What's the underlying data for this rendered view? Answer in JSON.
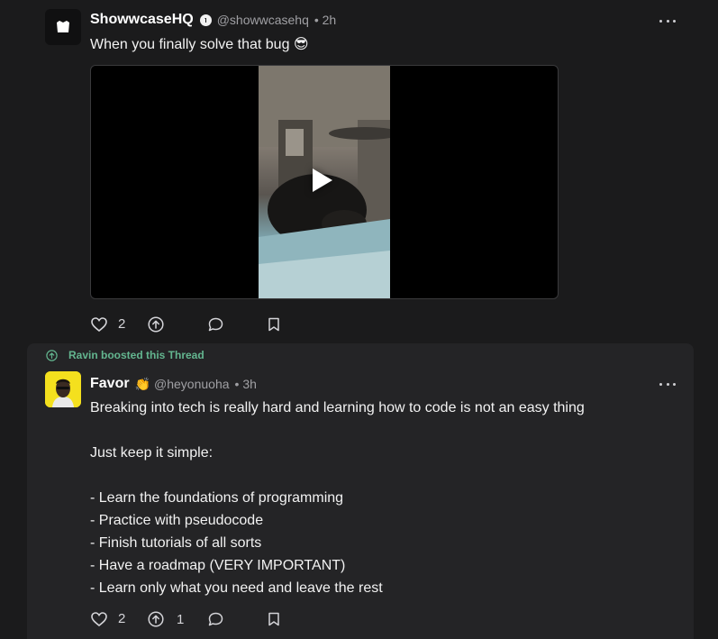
{
  "posts": [
    {
      "display_name": "ShowwcaseHQ",
      "handle": "@showwcasehq",
      "time": "• 2h",
      "text": "When you finally solve that bug 😎",
      "media": {
        "type": "video",
        "play_icon": "play-icon"
      },
      "likes": "2",
      "boosts": "",
      "icons": [
        "heart-icon",
        "boost-icon",
        "comment-icon",
        "bookmark-icon",
        "more-icon",
        "verified-icon"
      ]
    },
    {
      "boost_label": "Ravin boosted this Thread",
      "display_name": "Favor",
      "emoji": "👏",
      "handle": "@heyonuoha",
      "time": "• 3h",
      "text": "Breaking into tech is really hard and learning how to code is not an easy thing\n\nJust keep it simple:\n\n- Learn the foundations of programming\n- Practice with pseudocode\n- Finish tutorials of all sorts\n- Have a roadmap (VERY IMPORTANT)\n- Learn only what you need and leave the rest",
      "likes": "2",
      "boosts": "1",
      "icons": [
        "heart-icon",
        "boost-icon",
        "comment-icon",
        "bookmark-icon",
        "more-icon"
      ]
    }
  ],
  "colors": {
    "background": "#1b1b1c",
    "card": "#242426",
    "boost_accent": "#63b58f",
    "favor_avatar": "#f4e01e"
  }
}
